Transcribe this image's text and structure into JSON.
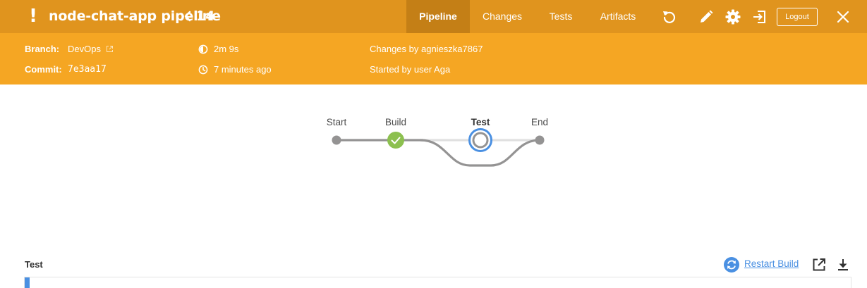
{
  "header": {
    "status_symbol": "!",
    "pipeline_name": "node-chat-app pipeline",
    "run_number": "14",
    "tabs": [
      {
        "label": "Pipeline",
        "active": true
      },
      {
        "label": "Changes",
        "active": false
      },
      {
        "label": "Tests",
        "active": false
      },
      {
        "label": "Artifacts",
        "active": false
      }
    ],
    "icons": [
      "replay-icon",
      "edit-icon",
      "gear-icon",
      "exit-icon",
      "close-icon"
    ],
    "logout_label": "Logout",
    "colors": {
      "header_bg": "#e0941e",
      "active_tab_bg": "#c47f16"
    }
  },
  "info": {
    "branch_label": "Branch:",
    "branch_value": "DevOps",
    "commit_label": "Commit:",
    "commit_value": "7e3aa17",
    "duration": "2m 9s",
    "time_ago": "7 minutes ago",
    "changes_by": "Changes by agnieszka7867",
    "started_by": "Started by user Aga",
    "colors": {
      "info_bg": "#f5a623"
    }
  },
  "graph": {
    "stages": [
      {
        "name": "Start",
        "state": "start"
      },
      {
        "name": "Build",
        "state": "success"
      },
      {
        "name": "Test",
        "state": "running",
        "current": true
      },
      {
        "name": "End",
        "state": "end"
      }
    ],
    "colors": {
      "success": "#8cc04f",
      "running": "#4a90e2",
      "line": "#949393"
    }
  },
  "log": {
    "stage_title": "Test",
    "restart_label": "Restart Build",
    "link_color": "#4a90e2"
  }
}
